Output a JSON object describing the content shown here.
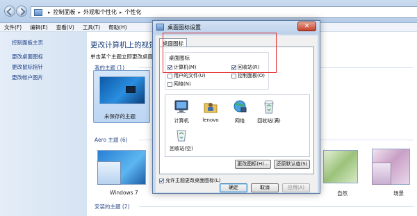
{
  "address_bar": {
    "crumbs": [
      "控制面板",
      "外观和个性化",
      "个性化"
    ]
  },
  "menu": [
    "文件(F)",
    "编辑(E)",
    "查看(V)",
    "工具(T)",
    "帮助(H)"
  ],
  "left_pane": {
    "items": [
      "控制面板主页",
      "更改桌面图标",
      "更改鼠标指针",
      "更改帐户图片"
    ]
  },
  "content": {
    "title": "更改计算机上的视觉效",
    "subtitle": "单击某个主题立即更改桌面背",
    "my_themes": "我的主题 (1)",
    "unsaved_theme": "未保存的主题",
    "aero_themes": "Aero 主题 (6)",
    "windows7": "Windows 7",
    "nature": "自然",
    "scenes": "场景",
    "installed_themes": "安装的主题 (2)"
  },
  "dialog": {
    "title": "桌面图标设置",
    "close_label": "✕",
    "tab_label": "桌面图标",
    "group_title": "桌面图标",
    "checkboxes": [
      {
        "label": "计算机(M)",
        "checked": true
      },
      {
        "label": "回收站(R)",
        "checked": true
      },
      {
        "label": "用户的文件(U)",
        "checked": false
      },
      {
        "label": "控制面板(O)",
        "checked": false
      },
      {
        "label": "网络(N)",
        "checked": false
      }
    ],
    "icons": [
      "计算机",
      "lenovo",
      "网络",
      "回收站(满)",
      "回收站(空)"
    ],
    "change_icon": "更改图标(H)...",
    "restore_default": "还原默认值(S)",
    "allow_themes": "允许主题更改桌面图标(L)",
    "allow_themes_checked": true,
    "ok": "确定",
    "cancel": "取消",
    "apply": "应用(A)"
  }
}
